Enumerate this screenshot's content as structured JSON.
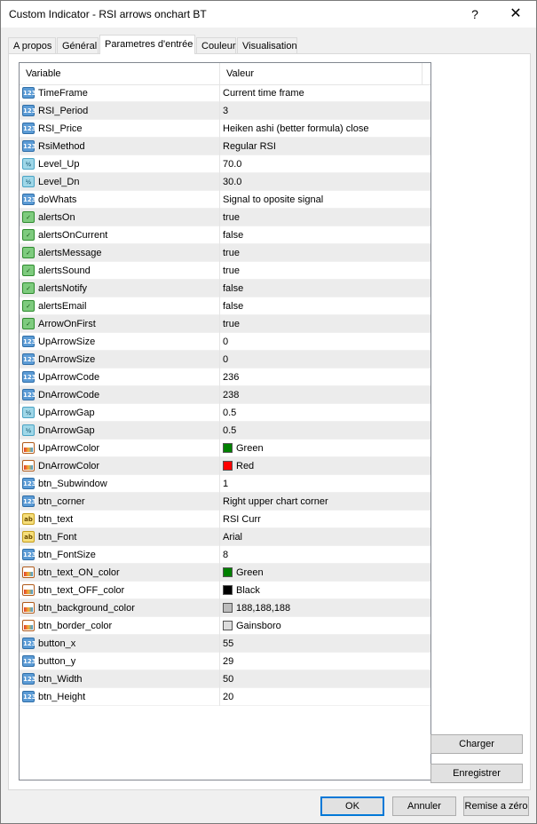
{
  "window": {
    "title": "Custom Indicator - RSI arrows onchart BT",
    "help": "?",
    "close": "✕"
  },
  "tabs": [
    "A propos",
    "Général",
    "Parametres d'entrée",
    "Couleur",
    "Visualisation"
  ],
  "grid": {
    "col_variable": "Variable",
    "col_value": "Valeur",
    "rows": [
      {
        "icon": "int",
        "name": "TimeFrame",
        "value": "Current time frame"
      },
      {
        "icon": "int",
        "name": "RSI_Period",
        "value": "3"
      },
      {
        "icon": "int",
        "name": "RSI_Price",
        "value": "Heiken ashi (better formula) close"
      },
      {
        "icon": "int",
        "name": "RsiMethod",
        "value": "Regular RSI"
      },
      {
        "icon": "dbl",
        "name": "Level_Up",
        "value": "70.0"
      },
      {
        "icon": "dbl",
        "name": "Level_Dn",
        "value": "30.0"
      },
      {
        "icon": "int",
        "name": "doWhats",
        "value": "Signal to oposite signal"
      },
      {
        "icon": "bool",
        "name": "alertsOn",
        "value": "true"
      },
      {
        "icon": "bool",
        "name": "alertsOnCurrent",
        "value": "false"
      },
      {
        "icon": "bool",
        "name": "alertsMessage",
        "value": "true"
      },
      {
        "icon": "bool",
        "name": "alertsSound",
        "value": "true"
      },
      {
        "icon": "bool",
        "name": "alertsNotify",
        "value": "false"
      },
      {
        "icon": "bool",
        "name": "alertsEmail",
        "value": "false"
      },
      {
        "icon": "bool",
        "name": "ArrowOnFirst",
        "value": "true"
      },
      {
        "icon": "int",
        "name": "UpArrowSize",
        "value": "0"
      },
      {
        "icon": "int",
        "name": "DnArrowSize",
        "value": "0"
      },
      {
        "icon": "int",
        "name": "UpArrowCode",
        "value": "236"
      },
      {
        "icon": "int",
        "name": "DnArrowCode",
        "value": "238"
      },
      {
        "icon": "dbl",
        "name": "UpArrowGap",
        "value": "0.5"
      },
      {
        "icon": "dbl",
        "name": "DnArrowGap",
        "value": "0.5"
      },
      {
        "icon": "clr",
        "name": "UpArrowColor",
        "value": "Green",
        "swatch": "#008000"
      },
      {
        "icon": "clr",
        "name": "DnArrowColor",
        "value": "Red",
        "swatch": "#ff0000"
      },
      {
        "icon": "int",
        "name": "btn_Subwindow",
        "value": "1"
      },
      {
        "icon": "int",
        "name": "btn_corner",
        "value": "Right upper chart corner"
      },
      {
        "icon": "str",
        "name": "btn_text",
        "value": "RSI Curr"
      },
      {
        "icon": "str",
        "name": "btn_Font",
        "value": "Arial"
      },
      {
        "icon": "int",
        "name": "btn_FontSize",
        "value": "8"
      },
      {
        "icon": "clr",
        "name": "btn_text_ON_color",
        "value": "Green",
        "swatch": "#008000"
      },
      {
        "icon": "clr",
        "name": "btn_text_OFF_color",
        "value": "Black",
        "swatch": "#000000"
      },
      {
        "icon": "clr",
        "name": "btn_background_color",
        "value": "188,188,188",
        "swatch": "#bcbcbc"
      },
      {
        "icon": "clr",
        "name": "btn_border_color",
        "value": "Gainsboro",
        "swatch": "#dcdcdc"
      },
      {
        "icon": "int",
        "name": "button_x",
        "value": "55"
      },
      {
        "icon": "int",
        "name": "button_y",
        "value": "29"
      },
      {
        "icon": "int",
        "name": "btn_Width",
        "value": "50"
      },
      {
        "icon": "int",
        "name": "btn_Height",
        "value": "20"
      }
    ]
  },
  "icon_glyphs": {
    "int": "123",
    "dbl": "½",
    "bool": "✓",
    "enm": "≡",
    "str": "ab",
    "clr": ""
  },
  "side_buttons": {
    "load": "Charger",
    "save": "Enregistrer"
  },
  "footer": {
    "ok": "OK",
    "cancel": "Annuler",
    "reset": "Remise a zéro"
  }
}
